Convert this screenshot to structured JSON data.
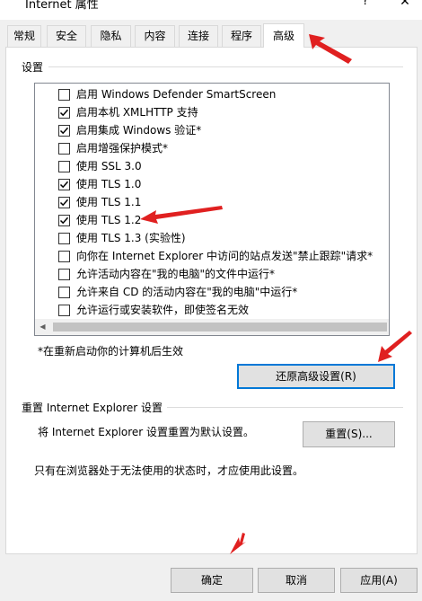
{
  "window": {
    "title": "Internet 属性",
    "help_label": "?",
    "close_label": "✕"
  },
  "tabs": [
    {
      "label": "常规"
    },
    {
      "label": "安全"
    },
    {
      "label": "隐私"
    },
    {
      "label": "内容"
    },
    {
      "label": "连接"
    },
    {
      "label": "程序"
    },
    {
      "label": "高级"
    }
  ],
  "active_tab": "高级",
  "settings": {
    "group_label": "设置",
    "items": [
      {
        "label": "启用 Windows Defender SmartScreen",
        "checked": false
      },
      {
        "label": "启用本机 XMLHTTP 支持",
        "checked": true
      },
      {
        "label": "启用集成 Windows 验证*",
        "checked": true
      },
      {
        "label": "启用增强保护模式*",
        "checked": false
      },
      {
        "label": "使用 SSL 3.0",
        "checked": false
      },
      {
        "label": "使用 TLS 1.0",
        "checked": true
      },
      {
        "label": "使用 TLS 1.1",
        "checked": true
      },
      {
        "label": "使用 TLS 1.2",
        "checked": true
      },
      {
        "label": "使用 TLS 1.3 (实验性)",
        "checked": false
      },
      {
        "label": "向你在 Internet Explorer 中访问的站点发送\"禁止跟踪\"请求*",
        "checked": false
      },
      {
        "label": "允许活动内容在\"我的电脑\"的文件中运行*",
        "checked": false
      },
      {
        "label": "允许来自 CD 的活动内容在\"我的电脑\"中运行*",
        "checked": false
      },
      {
        "label": "允许运行或安装软件，即使签名无效",
        "checked": false
      }
    ],
    "restart_note": "*在重新启动你的计算机后生效",
    "restore_button": "还原高级设置(R)"
  },
  "reset": {
    "group_label": "重置 Internet Explorer 设置",
    "description": "将 Internet Explorer 设置重置为默认设置。",
    "reset_button": "重置(S)...",
    "note": "只有在浏览器处于无法使用的状态时，才应使用此设置。"
  },
  "footer": {
    "ok": "确定",
    "cancel": "取消",
    "apply": "应用(A)"
  },
  "colors": {
    "annotation_arrow": "#e02020",
    "focus_border": "#0078d7"
  },
  "annotations": [
    "arrow-to-advanced-tab",
    "arrow-to-tls-1-2",
    "arrow-to-restore-button",
    "arrow-to-ok-button"
  ]
}
